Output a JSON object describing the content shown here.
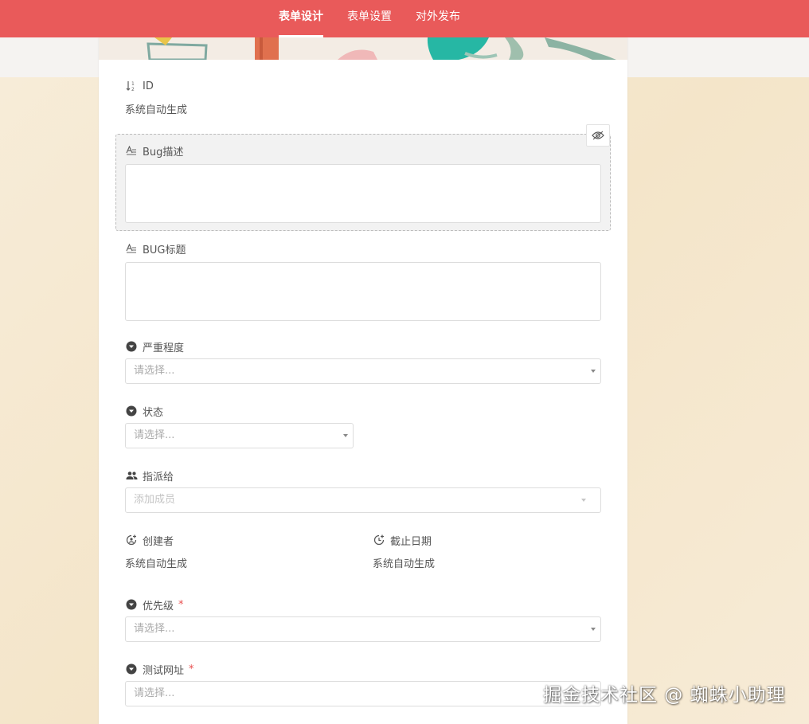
{
  "topbar": {
    "accent_color": "#e95a5a",
    "tabs": [
      {
        "label": "表单设计",
        "active": true
      },
      {
        "label": "表单设置",
        "active": false
      },
      {
        "label": "对外发布",
        "active": false
      }
    ]
  },
  "form": {
    "fields": {
      "id": {
        "label": "ID",
        "value": "系统自动生成",
        "icon": "sort-number-icon"
      },
      "bug_desc": {
        "label": "Bug描述",
        "icon": "text-format-icon",
        "selected": true
      },
      "bug_title": {
        "label": "BUG标题",
        "icon": "text-format-icon"
      },
      "severity": {
        "label": "严重程度",
        "placeholder": "请选择...",
        "icon": "dropdown-circle-icon"
      },
      "status": {
        "label": "状态",
        "placeholder": "请选择...",
        "icon": "dropdown-circle-icon"
      },
      "assignee": {
        "label": "指派给",
        "placeholder": "添加成员",
        "icon": "people-icon"
      },
      "creator": {
        "label": "创建者",
        "value": "系统自动生成",
        "icon": "user-add-icon"
      },
      "deadline": {
        "label": "截止日期",
        "value": "系统自动生成",
        "icon": "clock-add-icon"
      },
      "priority": {
        "label": "优先级",
        "placeholder": "请选择...",
        "required": "*",
        "icon": "dropdown-circle-icon"
      },
      "test_url": {
        "label": "测试网址",
        "placeholder": "请选择...",
        "required": "*",
        "icon": "dropdown-circle-icon"
      }
    },
    "toolbar": {
      "visibility_icon": "eye-icon"
    }
  },
  "watermark": {
    "text": "掘金技术社区 @ 蜘蛛小助理"
  }
}
